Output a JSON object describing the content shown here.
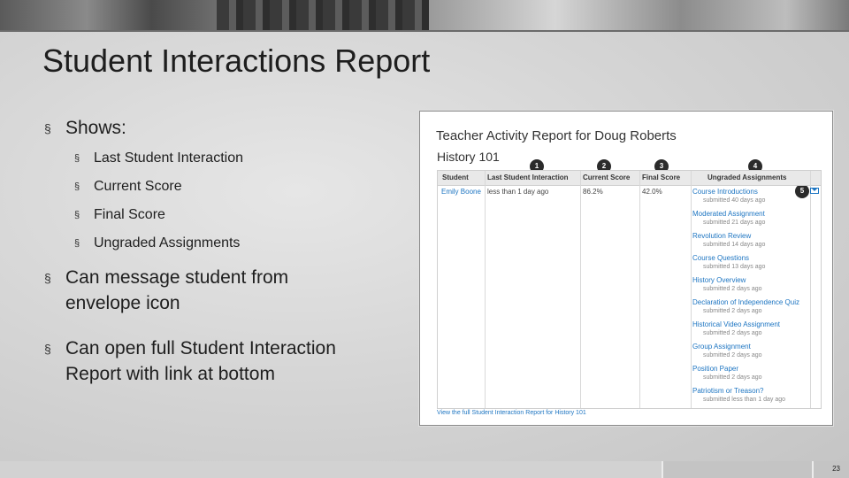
{
  "slide": {
    "title": "Student Interactions Report",
    "page_number": "23"
  },
  "bullets": {
    "marker": "§",
    "shows": "Shows:",
    "sub_items": [
      "Last Student Interaction",
      "Current Score",
      "Final Score",
      "Ungraded Assignments"
    ],
    "message": "Can message student from envelope icon",
    "open_report": "Can open full Student Interaction Report with link at bottom"
  },
  "report": {
    "title": "Teacher Activity Report for Doug Roberts",
    "course": "History 101",
    "columns": [
      "Student",
      "Last Student Interaction",
      "Current Score",
      "Final Score",
      "Ungraded Assignments"
    ],
    "row": {
      "student": "Emily Boone",
      "last_interaction": "less than 1 day ago",
      "current_score": "86.2%",
      "final_score": "42.0%"
    },
    "assignments": [
      {
        "name": "Course Introductions",
        "submitted": "submitted 40 days ago"
      },
      {
        "name": "Moderated Assignment",
        "submitted": "submitted 21 days ago"
      },
      {
        "name": "Revolution Review",
        "submitted": "submitted 14 days ago"
      },
      {
        "name": "Course Questions",
        "submitted": "submitted 13 days ago"
      },
      {
        "name": "History Overview",
        "submitted": "submitted 2 days ago"
      },
      {
        "name": "Declaration of Independence Quiz",
        "submitted": "submitted 2 days ago"
      },
      {
        "name": "Historical Video Assignment",
        "submitted": "submitted 2 days ago"
      },
      {
        "name": "Group Assignment",
        "submitted": "submitted 2 days ago"
      },
      {
        "name": "Position Paper",
        "submitted": "submitted 2 days ago"
      },
      {
        "name": "Patriotism or Treason?",
        "submitted": "submitted less than 1 day ago"
      }
    ],
    "badges": [
      "1",
      "2",
      "3",
      "4",
      "5"
    ],
    "footer_link": "View the full Student Interaction Report for History 101",
    "icons": {
      "envelope": "envelope-icon"
    },
    "colors": {
      "link": "#1d75c2",
      "badge": "#2b2b2b"
    }
  }
}
